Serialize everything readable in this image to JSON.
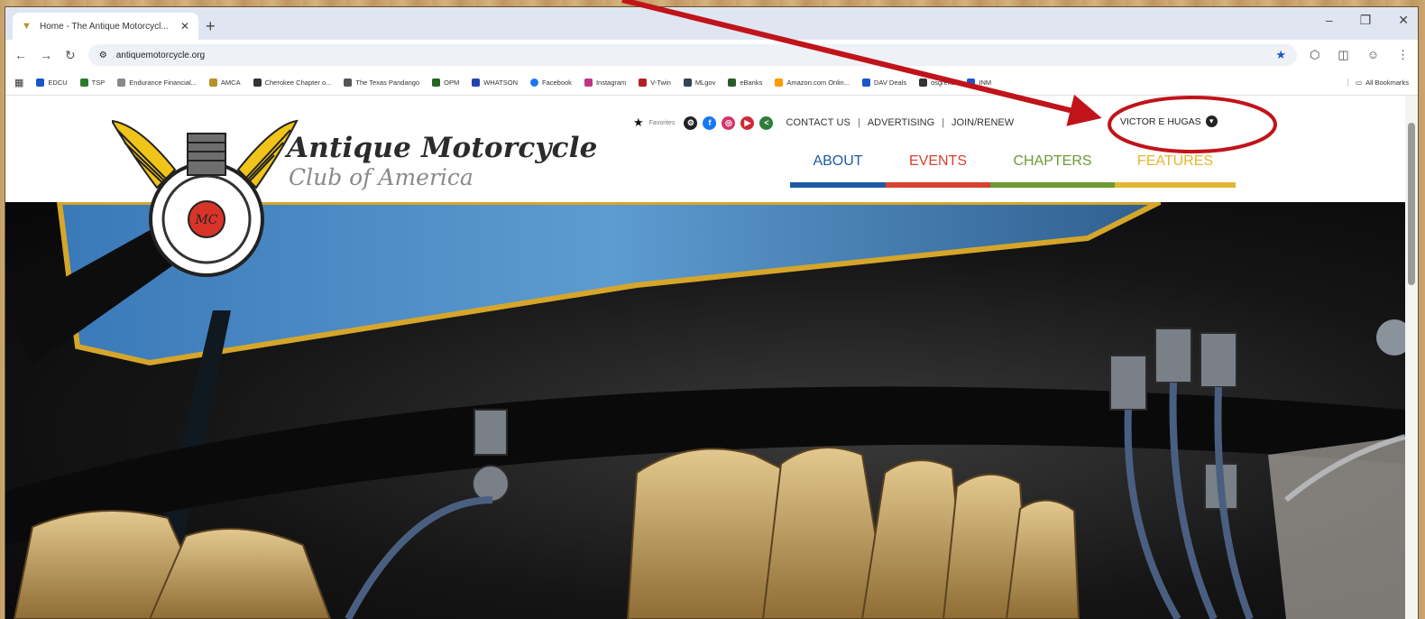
{
  "browser": {
    "tab_title": "Home - The Antique Motorcycl...",
    "url": "antiquemotorcycle.org",
    "bookmarks": [
      {
        "label": "EDCU",
        "color": "#1a56c8"
      },
      {
        "label": "TSP",
        "color": "#2b7a2b"
      },
      {
        "label": "Endurance Financial...",
        "color": "#888888"
      },
      {
        "label": "AMCA",
        "color": "#b8902a"
      },
      {
        "label": "Cherokee Chapter o...",
        "color": "#333333"
      },
      {
        "label": "The Texas Pandango",
        "color": "#555555"
      },
      {
        "label": "OPM",
        "color": "#226622"
      },
      {
        "label": "WHATSON",
        "color": "#2244aa"
      },
      {
        "label": "Facebook",
        "color": "#1877f2"
      },
      {
        "label": "Instagram",
        "color": "#c13584"
      },
      {
        "label": "V-Twin",
        "color": "#b22222"
      },
      {
        "label": "MLgov",
        "color": "#334455"
      },
      {
        "label": "eBanks",
        "color": "#2a5a2a"
      },
      {
        "label": "Amazon.com Onlin...",
        "color": "#ff9900"
      },
      {
        "label": "DAV Deals",
        "color": "#1a56c8"
      },
      {
        "label": "osgreks",
        "color": "#333333"
      },
      {
        "label": "INM",
        "color": "#1a56c8"
      }
    ],
    "all_bookmarks": "All Bookmarks"
  },
  "site": {
    "title": "Antique Motorcycle",
    "subtitle": "Club of America",
    "logo_text": "MC",
    "favorites_label": "Favorites",
    "links": {
      "contact": "CONTACT US",
      "advertising": "ADVERTISING",
      "join": "JOIN/RENEW"
    },
    "separator": "|",
    "user_name": "VICTOR E HUGAS",
    "nav": {
      "about": "ABOUT",
      "events": "EVENTS",
      "chapters": "CHAPTERS",
      "features": "FEATURES"
    },
    "colors": {
      "about": "#1d5aa6",
      "events": "#d8412f",
      "chapters": "#6e9a33",
      "features": "#e2b630",
      "annotation": "#c0141a"
    }
  }
}
